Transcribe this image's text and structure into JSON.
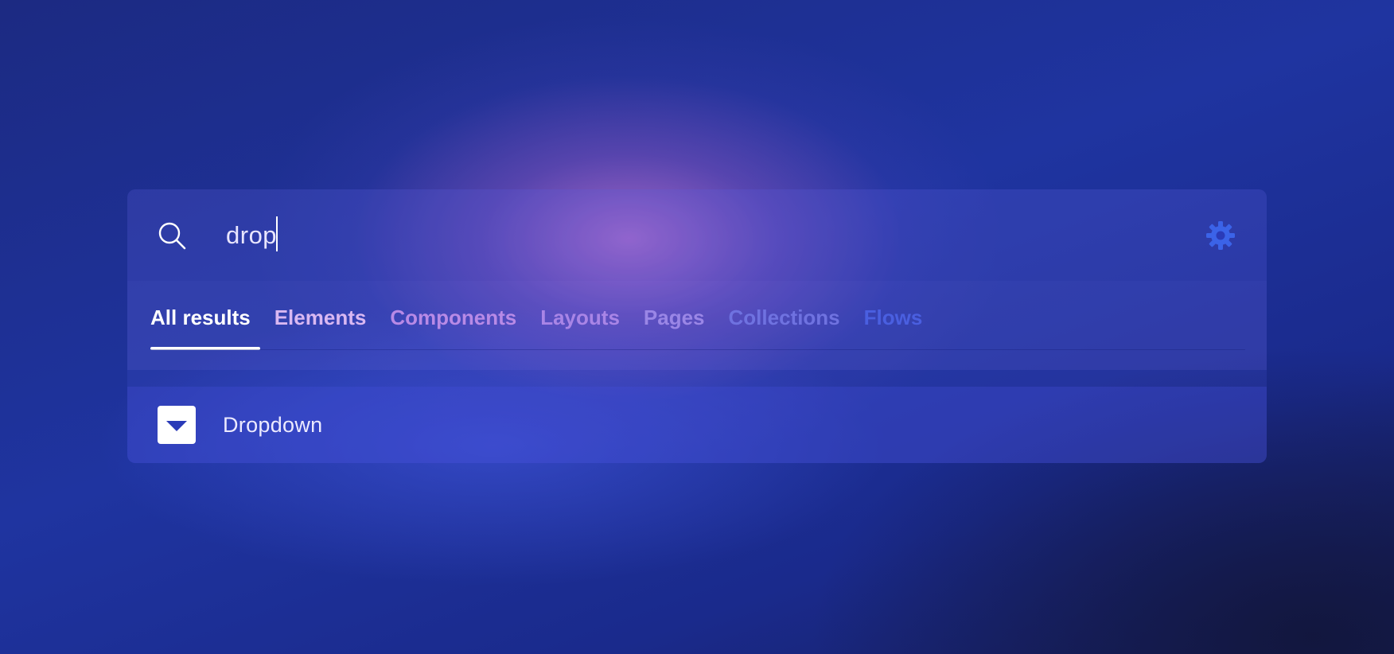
{
  "search": {
    "query": "drop",
    "icon": "search-icon"
  },
  "settings": {
    "icon": "gear-icon",
    "color": "#3b63e8"
  },
  "tabs": [
    {
      "label": "All results",
      "color": "#ffffff",
      "active": true
    },
    {
      "label": "Elements",
      "color": "#d9b8f2",
      "active": false
    },
    {
      "label": "Components",
      "color": "#b88ae6",
      "active": false
    },
    {
      "label": "Layouts",
      "color": "#a985e6",
      "active": false
    },
    {
      "label": "Pages",
      "color": "#9a86e6",
      "active": false
    },
    {
      "label": "Collections",
      "color": "#6f72e0",
      "active": false
    },
    {
      "label": "Flows",
      "color": "#4a5fe0",
      "active": false
    }
  ],
  "results": [
    {
      "label": "Dropdown",
      "icon": "dropdown-icon"
    }
  ]
}
